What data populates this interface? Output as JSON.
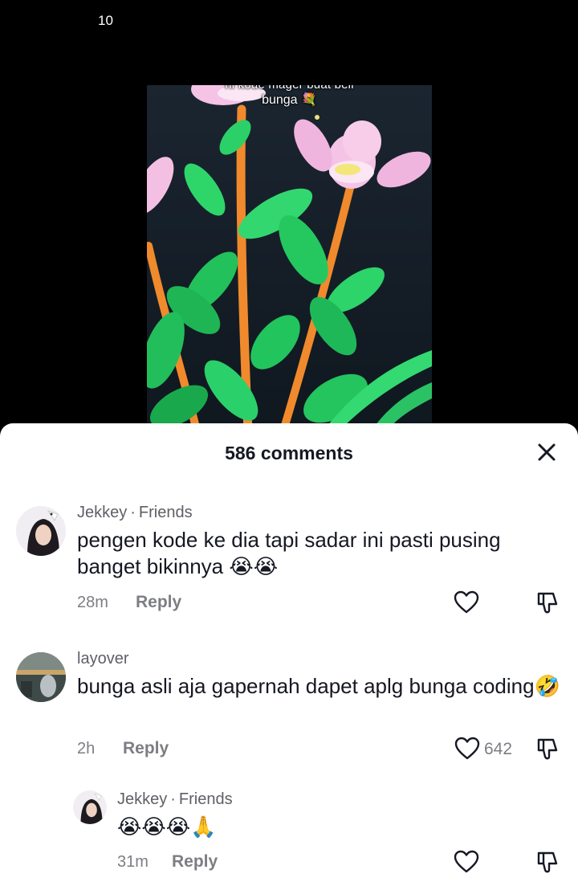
{
  "status": {
    "time": "10"
  },
  "video": {
    "caption_top": "ni kode mager buat beli",
    "caption": "bunga 💐"
  },
  "comments_sheet": {
    "title": "586 comments",
    "comments": [
      {
        "author": "Jekkey",
        "relation": "Friends",
        "text": "pengen kode ke dia tapi sadar ini pasti pusing banget bikinnya 😭😭",
        "time": "28m",
        "reply_label": "Reply",
        "likes": ""
      },
      {
        "author": "layover",
        "relation": "",
        "text": "bunga asli aja gapernah dapet aplg bunga coding🤣",
        "time": "2h",
        "reply_label": "Reply",
        "likes": "642"
      },
      {
        "author": "Jekkey",
        "relation": "Friends",
        "text": "😭😭😭🙏",
        "time": "31m",
        "reply_label": "Reply",
        "likes": ""
      }
    ]
  },
  "colors": {
    "sheet_bg": "#ffffff",
    "text_primary": "#161823",
    "text_secondary": "#7d7e84"
  },
  "icons": [
    "close-icon",
    "heart-icon",
    "dislike-icon"
  ]
}
